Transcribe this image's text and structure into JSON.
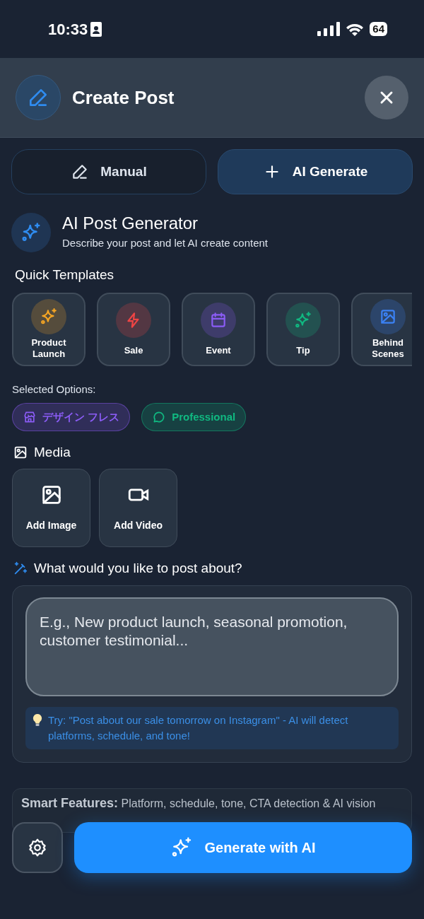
{
  "status_bar": {
    "time": "10:33",
    "battery": "64"
  },
  "header": {
    "title": "Create Post"
  },
  "mode_tabs": [
    {
      "label": "Manual",
      "kind": "pencil",
      "selected": false
    },
    {
      "label": "AI Generate",
      "kind": "plus",
      "selected": true
    }
  ],
  "generator": {
    "title": "AI Post Generator",
    "subtitle": "Describe your post and let AI create content"
  },
  "quick_templates": {
    "heading": "Quick Templates",
    "items": [
      {
        "label": "Product Launch",
        "kind": "sparkles",
        "color": "#f5a524"
      },
      {
        "label": "Sale",
        "kind": "bolt",
        "color": "#ef4444"
      },
      {
        "label": "Event",
        "kind": "calendar",
        "color": "#8b5cf6"
      },
      {
        "label": "Tip",
        "kind": "sparkles",
        "color": "#10b981"
      },
      {
        "label": "Behind Scenes",
        "kind": "image",
        "color": "#3b82f6"
      }
    ]
  },
  "selected_options": {
    "label": "Selected Options:",
    "chips": [
      {
        "label": "デザイン フレス",
        "kind": "store",
        "color": "#8b5cf6"
      },
      {
        "label": "Professional",
        "kind": "chat",
        "color": "#10b981"
      }
    ]
  },
  "media": {
    "heading": "Media",
    "buttons": [
      {
        "label": "Add Image",
        "kind": "image"
      },
      {
        "label": "Add Video",
        "kind": "video"
      }
    ]
  },
  "prompt": {
    "heading": "What would you like to post about?",
    "placeholder": "E.g., New product launch, seasonal promotion, customer testimonial...",
    "tip": "Try: \"Post about our sale tomorrow on Instagram\" - AI will detect platforms, schedule, and tone!"
  },
  "smart_features": {
    "text": "**Smart Features:** Platform, schedule, tone, CTA detection & AI vision"
  },
  "generate_button": {
    "label": "Generate with AI"
  }
}
